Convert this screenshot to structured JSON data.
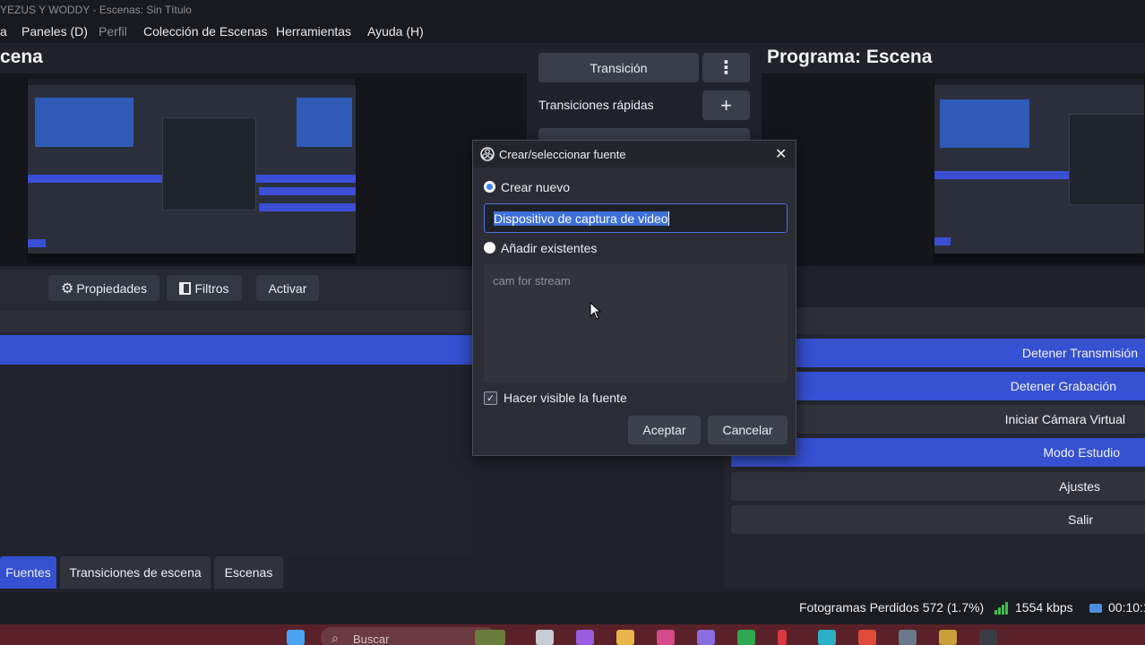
{
  "titlebar": {
    "text": "YEZUS Y WODDY - Escenas: Sin Título"
  },
  "menu": [
    "a",
    "Paneles (D)",
    "Perfil",
    "Colección de Escenas",
    "Herramientas",
    "Ayuda (H)"
  ],
  "preview": {
    "title": "cena"
  },
  "program": {
    "title": "Programa: Escena"
  },
  "transitions": {
    "transition_label": "Transición",
    "quick_label": "Transiciones rápidas",
    "more_icon": "⋮",
    "add_icon": "+"
  },
  "source_toolbar": {
    "properties": "Propiedades",
    "filters": "Filtros",
    "activate": "Activar"
  },
  "controls": [
    "Detener Transmisión",
    "Detener Grabación",
    "Iniciar Cámara Virtual",
    "Modo Estudio",
    "Ajustes",
    "Salir"
  ],
  "dock_tabs": [
    "Fuentes",
    "Transiciones de escena",
    "Escenas"
  ],
  "status": {
    "dropped_frames": "Fotogramas Perdidos 572 (1.7%)",
    "bitrate": "1554 kbps",
    "time": "00:10:1"
  },
  "taskbar": {
    "search_placeholder": "Buscar"
  },
  "dialog": {
    "title": "Crear/seleccionar fuente",
    "create_new_label": "Crear nuevo",
    "name_value": "Dispositivo de captura de video",
    "add_existing_label": "Añadir existentes",
    "existing_items": [
      "cam for stream"
    ],
    "visible_label": "Hacer visible la fuente",
    "visible_checked": true,
    "accept_label": "Aceptar",
    "cancel_label": "Cancelar",
    "close_icon": "✕"
  }
}
